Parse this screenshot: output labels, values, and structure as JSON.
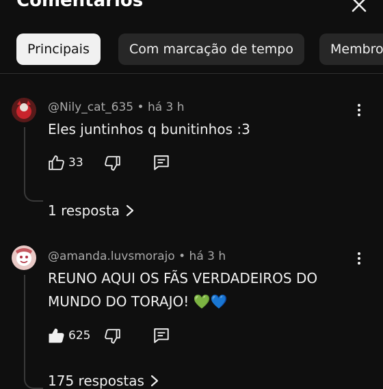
{
  "header": {
    "title": "Comentários"
  },
  "filters": [
    {
      "label": "Principais",
      "active": true
    },
    {
      "label": "Com marcação de tempo",
      "active": false
    },
    {
      "label": "Membros",
      "active": false
    }
  ],
  "comments": [
    {
      "author": "@Nily_cat_635",
      "time": "há 3 h",
      "text": "Eles juntinhos q bunitinhos :3",
      "likes": "33",
      "replies_label": "1 resposta",
      "liked": false
    },
    {
      "author": "@amanda.luvsmorajo",
      "time": "há 3 h",
      "text": "REUNO AQUI OS FÃS VERDADEIROS DO MUNDO DO TORAJO! 💚💙",
      "likes": "625",
      "replies_label": "175 respostas",
      "liked": true
    }
  ],
  "colors": {
    "background": "#0f0f0f",
    "chip": "#272727",
    "chip_active": "#f1f1f1",
    "meta": "#aaaaaa"
  },
  "icons": [
    "close-icon",
    "more-vert-icon",
    "thumbs-up-icon",
    "thumbs-down-icon",
    "reply-icon",
    "chevron-right-icon"
  ]
}
